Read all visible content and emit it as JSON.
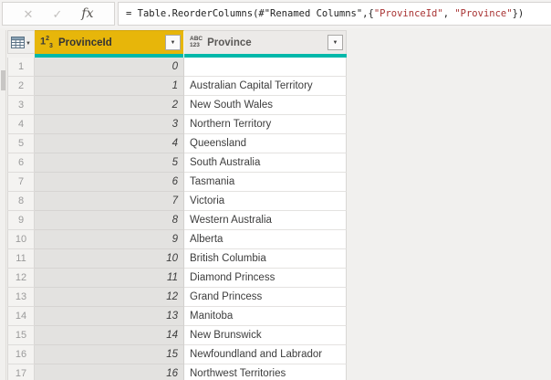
{
  "formula_bar": {
    "cancel_icon": "✕",
    "commit_icon": "✓",
    "fx_label": "fx",
    "formula_segments": [
      {
        "text": "= Table.ReorderColumns(#\"Renamed Columns\",{",
        "color": "default"
      },
      {
        "text": "\"ProvinceId\"",
        "color": "string"
      },
      {
        "text": ", ",
        "color": "default"
      },
      {
        "text": "\"Province\"",
        "color": "string"
      },
      {
        "text": "})",
        "color": "default"
      }
    ]
  },
  "colors": {
    "accent_teal": "#01B8AA",
    "selected_header_yellow": "#E7B60A",
    "string_literal_red": "#A83232"
  },
  "table": {
    "columns": [
      {
        "name": "ProvinceId",
        "type": "whole-number",
        "selected": true
      },
      {
        "name": "Province",
        "type": "any",
        "selected": false
      }
    ],
    "type_icon_abc_line1": "ABC",
    "type_icon_abc_line2": "123",
    "rows": [
      {
        "n": "1",
        "id": "0",
        "province": ""
      },
      {
        "n": "2",
        "id": "1",
        "province": "Australian Capital Territory"
      },
      {
        "n": "3",
        "id": "2",
        "province": "New South Wales"
      },
      {
        "n": "4",
        "id": "3",
        "province": "Northern Territory"
      },
      {
        "n": "5",
        "id": "4",
        "province": "Queensland"
      },
      {
        "n": "6",
        "id": "5",
        "province": "South Australia"
      },
      {
        "n": "7",
        "id": "6",
        "province": "Tasmania"
      },
      {
        "n": "8",
        "id": "7",
        "province": "Victoria"
      },
      {
        "n": "9",
        "id": "8",
        "province": "Western Australia"
      },
      {
        "n": "10",
        "id": "9",
        "province": "Alberta"
      },
      {
        "n": "11",
        "id": "10",
        "province": "British Columbia"
      },
      {
        "n": "12",
        "id": "11",
        "province": "Diamond Princess"
      },
      {
        "n": "13",
        "id": "12",
        "province": "Grand Princess"
      },
      {
        "n": "14",
        "id": "13",
        "province": "Manitoba"
      },
      {
        "n": "15",
        "id": "14",
        "province": "New Brunswick"
      },
      {
        "n": "16",
        "id": "15",
        "province": "Newfoundland and Labrador"
      },
      {
        "n": "17",
        "id": "16",
        "province": "Northwest Territories"
      }
    ]
  }
}
